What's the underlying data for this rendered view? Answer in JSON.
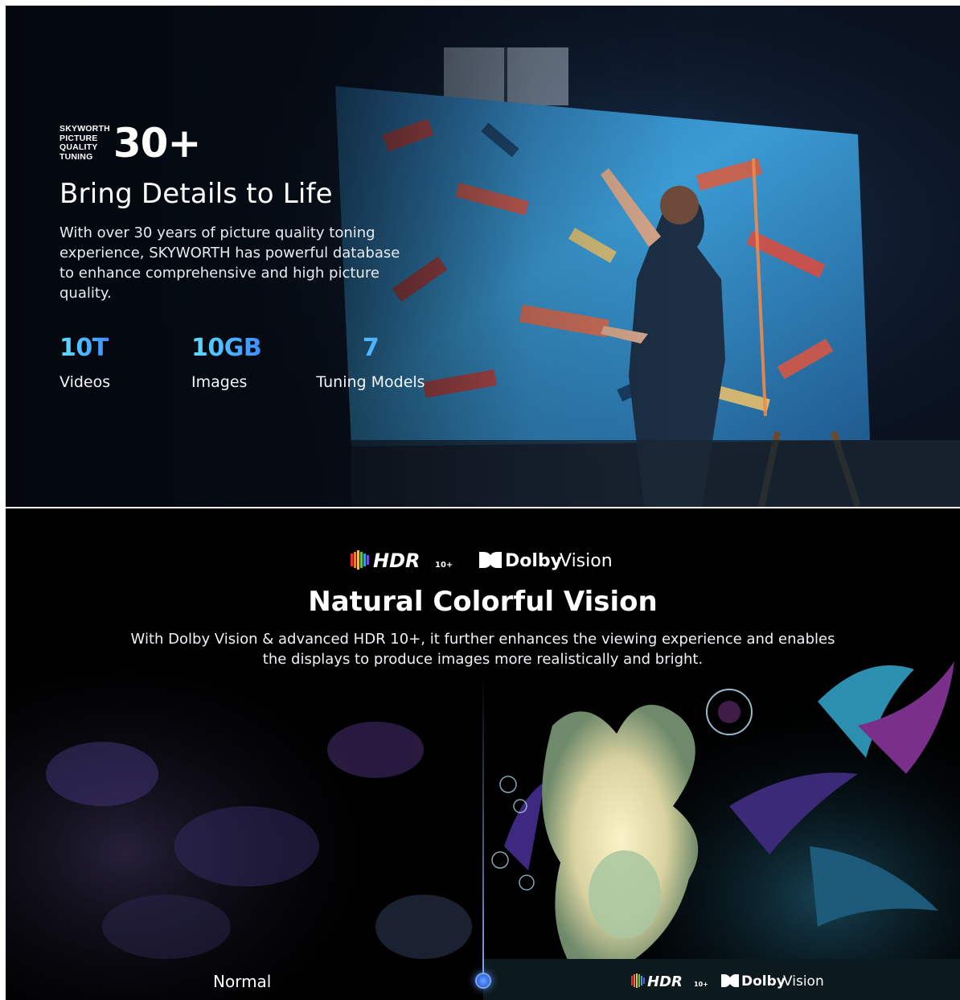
{
  "hero": {
    "tuning_lines": [
      "SKYWORTH",
      "PICTURE",
      "QUALITY",
      "TUNING"
    ],
    "tuning_value": "30+",
    "title": "Bring Details to Life",
    "description": "With over 30 years of picture quality toning experience, SKYWORTH has powerful database to enhance comprehensive and high picture quality.",
    "stats": [
      {
        "value": "10T",
        "label": "Videos"
      },
      {
        "value": "10GB",
        "label": "Images"
      },
      {
        "value": "7",
        "label": "Tuning Models"
      }
    ],
    "background_image": "painter-at-canvas"
  },
  "vision": {
    "logos": {
      "hdr": "HDR",
      "hdr_suffix": "10+",
      "dolby": "Dolby",
      "dolby_vision": "Vision"
    },
    "title": "Natural Colorful Vision",
    "description": "With Dolby Vision & advanced HDR 10+, it further enhances the viewing experience and enables the displays to produce images more realistically and bright.",
    "compare_left_label": "Normal",
    "background_image": "fantasy-glowing-creature-comparison"
  },
  "colors": {
    "stat_gradient_start": "#5ee0ff",
    "stat_gradient_end": "#3f8dff",
    "slider_handle": "#3a74f0"
  }
}
